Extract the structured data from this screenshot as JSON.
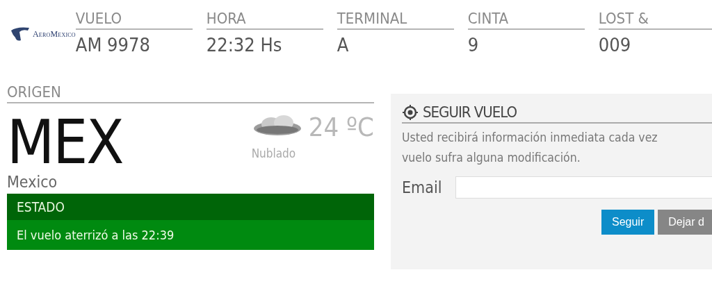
{
  "logo": {
    "text": "AeroMexico"
  },
  "flight_info": [
    {
      "label": "VUELO",
      "value": "AM 9978"
    },
    {
      "label": "HORA",
      "value": "22:32 Hs"
    },
    {
      "label": "TERMINAL",
      "value": "A"
    },
    {
      "label": "CINTA",
      "value": "9"
    },
    {
      "label": "LOST &",
      "value": "009"
    }
  ],
  "origin": {
    "label": "ORIGEN",
    "code": "MEX",
    "city": "Mexico",
    "weather": {
      "temperature": "24 ºC",
      "condition": "Nublado"
    }
  },
  "status": {
    "title": "ESTADO",
    "message": "El vuelo aterrizó a las 22:39"
  },
  "follow": {
    "title": "SEGUIR VUELO",
    "description_lines": [
      "Usted recibirá información inmediata cada vez",
      "vuelo sufra alguna modificación."
    ],
    "email_label": "Email",
    "buttons": [
      {
        "label": "Seguir",
        "kind": "primary"
      },
      {
        "label": "Dejar d",
        "kind": "secondary"
      }
    ]
  }
}
